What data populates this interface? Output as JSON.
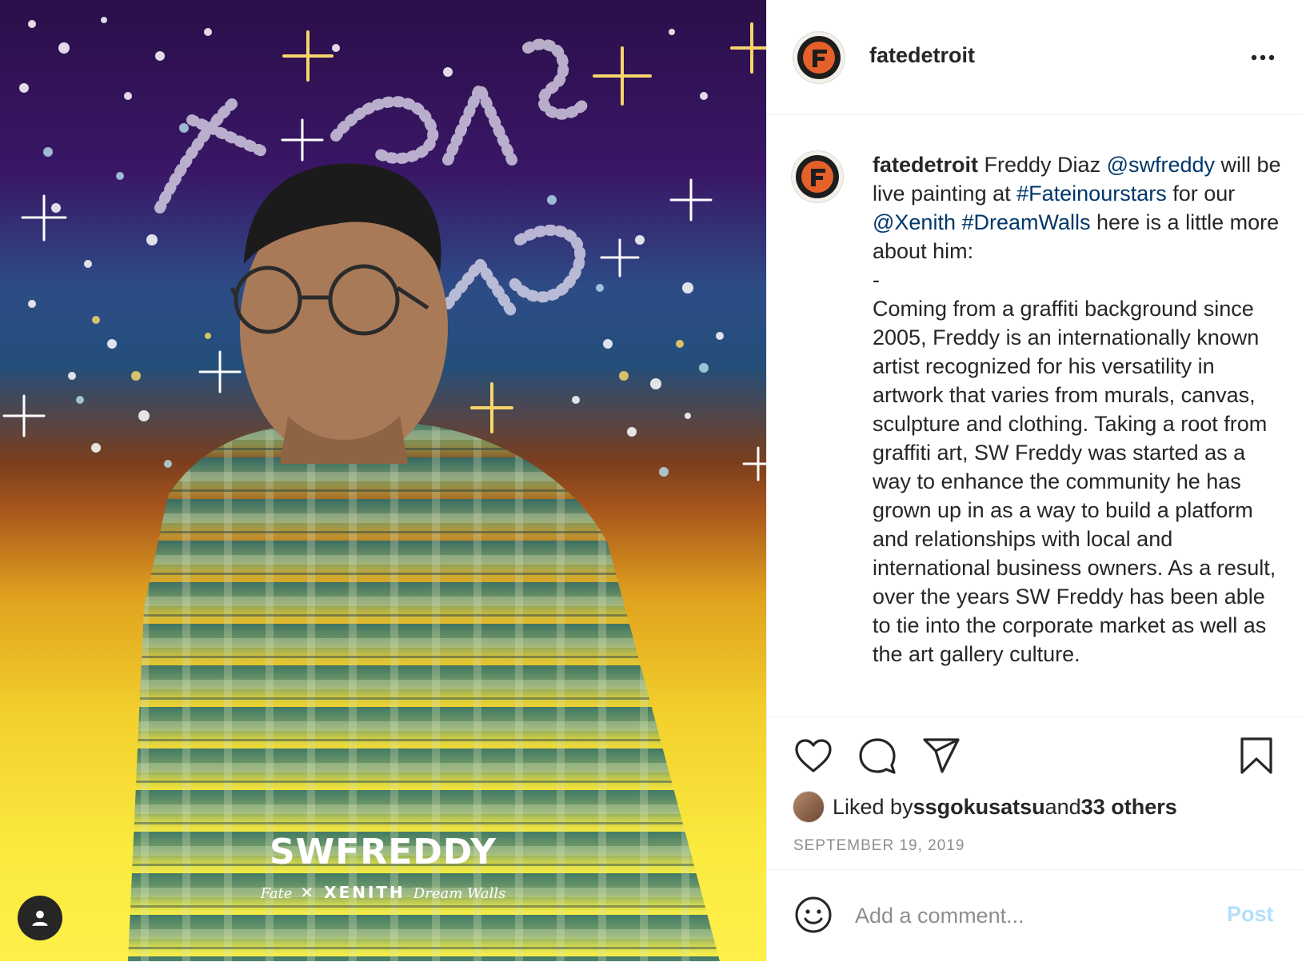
{
  "media": {
    "title": "SWFREDDY",
    "subtitle_left": "Fate",
    "subtitle_mid": "XENITH",
    "subtitle_right": "Dream Walls",
    "overlay_text": "the fate in our stars",
    "tag_icon": "user-icon"
  },
  "header": {
    "username": "fatedetroit",
    "more_icon": "more-horizontal-icon"
  },
  "caption": {
    "username": "fatedetroit",
    "t1": " Freddy Diaz ",
    "m1": "@swfreddy",
    "t2": " will be live painting at ",
    "h1": "#Fateinourstars",
    "t3": " for our ",
    "m2": "@Xenith",
    "t4": " ",
    "h2": "#DreamWalls",
    "t5": " here is a little more about him:\n-\nComing from a graffiti background since 2005, Freddy is an internationally known artist recognized for his versatility in artwork that varies from murals, canvas, sculpture and clothing. Taking a root from graffiti art, SW Freddy was started as a way to enhance the community he has grown up in as a way to build a platform and relationships with local and international business owners. As a result, over the years SW Freddy has been able to tie into the corporate market as well as the art gallery culture."
  },
  "actions": {
    "like_icon": "heart-icon",
    "comment_icon": "comment-icon",
    "share_icon": "paper-plane-icon",
    "save_icon": "bookmark-icon",
    "liked_prefix": "Liked by ",
    "liked_user": "ssgokusatsu",
    "liked_and": " and ",
    "liked_others": "33 others",
    "date": "SEPTEMBER 19, 2019"
  },
  "comment": {
    "placeholder": "Add a comment...",
    "post_label": "Post",
    "emoji_icon": "smiley-icon"
  },
  "colors": {
    "link": "#00376b",
    "post_disabled": "#b2dffc",
    "muted": "#8e8e8e",
    "text": "#262626"
  }
}
